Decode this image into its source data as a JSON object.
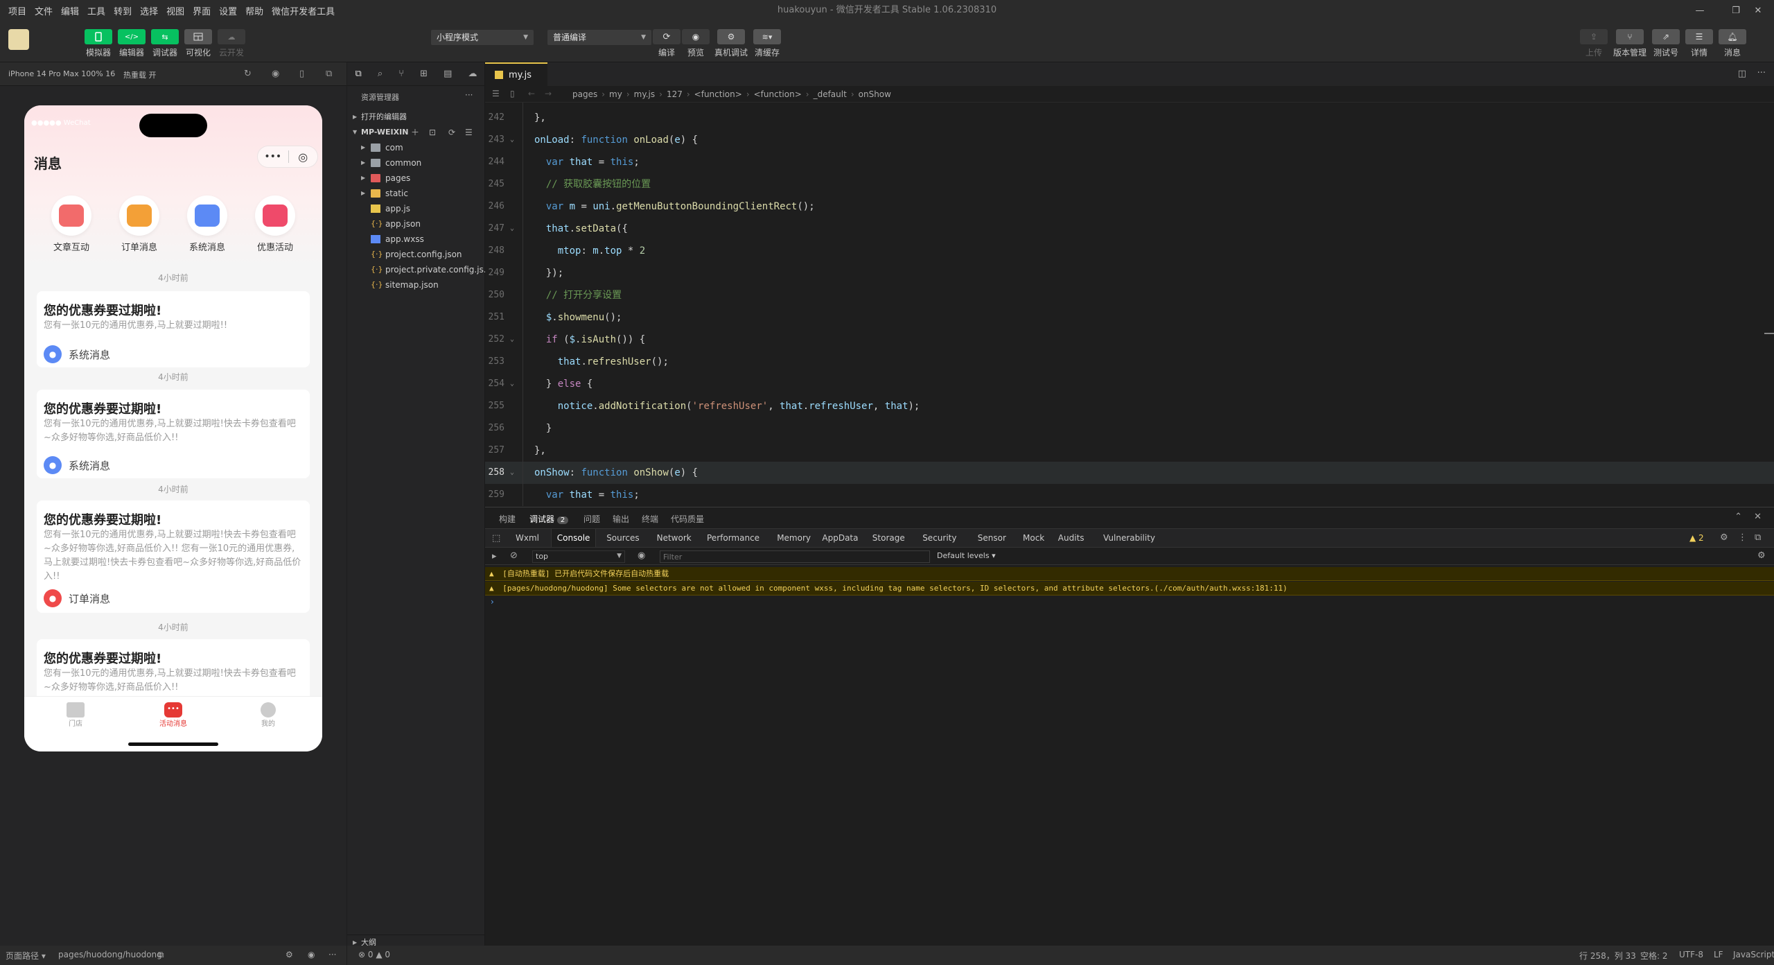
{
  "window": {
    "title": "huakouyun - 微信开发者工具 Stable 1.06.2308310",
    "menu": [
      "项目",
      "文件",
      "编辑",
      "工具",
      "转到",
      "选择",
      "视图",
      "界面",
      "设置",
      "帮助",
      "微信开发者工具"
    ]
  },
  "toolbar": {
    "left_buttons": [
      "模拟器",
      "编辑器",
      "调试器",
      "可视化",
      "云开发"
    ],
    "mode_select": "小程序模式",
    "compile_select": "普通编译",
    "mid_buttons": [
      "编译",
      "预览",
      "真机调试",
      "清缓存"
    ],
    "right_buttons": [
      "上传",
      "版本管理",
      "测试号",
      "详情",
      "消息"
    ]
  },
  "simulator": {
    "device": "iPhone 14 Pro Max 100% 16",
    "hot_reload": "热重载 开",
    "status_carrier": "●●●●● WeChat",
    "page_title": "消息",
    "categories": [
      {
        "label": "文章互动",
        "color": "#f26b6b"
      },
      {
        "label": "订单消息",
        "color": "#f3a037"
      },
      {
        "label": "系统消息",
        "color": "#5c8af5"
      },
      {
        "label": "优惠活动",
        "color": "#ef4a6a"
      }
    ],
    "messages": [
      {
        "time": "4小时前",
        "title": "您的优惠券要过期啦!",
        "desc": "您有一张10元的通用优惠券,马上就要过期啦!!",
        "tag": "系统消息",
        "tag_color": "#5c8af5"
      },
      {
        "time": "4小时前",
        "title": "您的优惠券要过期啦!",
        "desc": "您有一张10元的通用优惠券,马上就要过期啦!快去卡券包查看吧~众多好物等你选,好商品低价入!!",
        "tag": "系统消息",
        "tag_color": "#5c8af5"
      },
      {
        "time": "4小时前",
        "title": "您的优惠券要过期啦!",
        "desc": "您有一张10元的通用优惠券,马上就要过期啦!快去卡券包查看吧~众多好物等你选,好商品低价入!! 您有一张10元的通用优惠券,马上就要过期啦!快去卡券包查看吧~众多好物等你选,好商品低价入!!",
        "tag": "订单消息",
        "tag_color": "#ef4a4a"
      },
      {
        "time": "4小时前",
        "title": "您的优惠券要过期啦!",
        "desc": "您有一张10元的通用优惠券,马上就要过期啦!快去卡券包查看吧~众多好物等你选,好商品低价入!!",
        "tag": "",
        "tag_color": ""
      }
    ],
    "tabbar": [
      "门店",
      "活动消息",
      "我的"
    ],
    "tabbar_active_color": "#e53935"
  },
  "explorer": {
    "title": "资源管理器",
    "open_editors": "打开的编辑器",
    "root": "MP-WEIXIN",
    "items": [
      {
        "name": "com",
        "type": "folder",
        "color": "#9aa0a6"
      },
      {
        "name": "common",
        "type": "folder",
        "color": "#9aa0a6"
      },
      {
        "name": "pages",
        "type": "folder",
        "color": "#e05a5a"
      },
      {
        "name": "static",
        "type": "folder",
        "color": "#e8b64c"
      },
      {
        "name": "app.js",
        "type": "js",
        "color": "#e8c54c"
      },
      {
        "name": "app.json",
        "type": "json",
        "color": "#e8b64c"
      },
      {
        "name": "app.wxss",
        "type": "wxss",
        "color": "#5c8af5"
      },
      {
        "name": "project.config.json",
        "type": "json",
        "color": "#e8b64c"
      },
      {
        "name": "project.private.config.js...",
        "type": "json",
        "color": "#e8b64c"
      },
      {
        "name": "sitemap.json",
        "type": "json",
        "color": "#e8b64c"
      }
    ],
    "outline": "大纲"
  },
  "editor": {
    "tab": "my.js",
    "breadcrumb": [
      "pages",
      "my",
      "my.js",
      "127",
      "<function>",
      "<function>",
      "_default",
      "onShow"
    ],
    "lines": [
      {
        "n": "242",
        "html": "},"
      },
      {
        "n": "243",
        "html": "<span class='var'>onLoad</span>: <span class='kw'>function</span> <span class='fn'>onLoad</span>(<span class='var'>e</span>) {"
      },
      {
        "n": "244",
        "html": "  <span class='kw'>var</span> <span class='var'>that</span> = <span class='kw'>this</span>;"
      },
      {
        "n": "245",
        "html": "  <span class='cm'>// 获取胶囊按钮的位置</span>"
      },
      {
        "n": "246",
        "html": "  <span class='kw'>var</span> <span class='var'>m</span> = <span class='var'>uni</span>.<span class='fn'>getMenuButtonBoundingClientRect</span>();"
      },
      {
        "n": "247",
        "html": "  <span class='var'>that</span>.<span class='fn'>setData</span>({"
      },
      {
        "n": "248",
        "html": "    <span class='var'>mtop</span>: <span class='var'>m</span>.<span class='var'>top</span> * <span class='num'>2</span>"
      },
      {
        "n": "249",
        "html": "  });"
      },
      {
        "n": "250",
        "html": "  <span class='cm'>// 打开分享设置</span>"
      },
      {
        "n": "251",
        "html": "  <span class='var'>$</span>.<span class='fn'>showmenu</span>();"
      },
      {
        "n": "252",
        "html": "  <span class='ctl'>if</span> (<span class='var'>$</span>.<span class='fn'>isAuth</span>()) {"
      },
      {
        "n": "253",
        "html": "    <span class='var'>that</span>.<span class='fn'>refreshUser</span>();"
      },
      {
        "n": "254",
        "html": "  } <span class='ctl'>else</span> {"
      },
      {
        "n": "255",
        "html": "    <span class='var'>notice</span>.<span class='fn'>addNotification</span>(<span class='str'>'refreshUser'</span>, <span class='var'>that</span>.<span class='var'>refreshUser</span>, <span class='var'>that</span>);"
      },
      {
        "n": "256",
        "html": "  }"
      },
      {
        "n": "257",
        "html": "},"
      },
      {
        "n": "258",
        "html": "<span class='var'>onShow</span>: <span class='kw'>function</span> <span class='fn'>onShow</span>(<span class='var'>e</span>) {"
      },
      {
        "n": "259",
        "html": "  <span class='kw'>var</span> <span class='var'>that</span> = <span class='kw'>this</span>;"
      }
    ]
  },
  "debug": {
    "tabs": [
      "构建",
      "调试器",
      "问题",
      "输出",
      "终端",
      "代码质量"
    ],
    "debugger_badge": "2",
    "devtools_tabs": [
      "Wxml",
      "Console",
      "Sources",
      "Network",
      "Performance",
      "Memory",
      "AppData",
      "Storage",
      "Security",
      "Sensor",
      "Mock",
      "Audits",
      "Vulnerability"
    ],
    "warning_count": "2",
    "context": "top",
    "filter_placeholder": "Filter",
    "levels": "Default levels",
    "logs": [
      "[自动热重载] 已开启代码文件保存后自动热重载",
      "[pages/huodong/huodong] Some selectors are not allowed in component wxss, including tag name selectors, ID selectors, and attribute selectors.(./com/auth/auth.wxss:181:11)"
    ]
  },
  "status": {
    "page_path_label": "页面路径",
    "page_path": "pages/huodong/huodong",
    "errors": "0",
    "warnings": "0",
    "cursor": "行 258，列 33",
    "spaces": "空格: 2",
    "encoding": "UTF-8",
    "eol": "LF",
    "language": "JavaScript"
  }
}
